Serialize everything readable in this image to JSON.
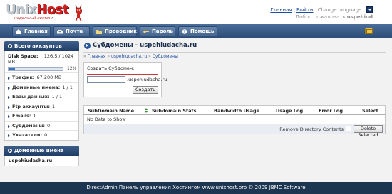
{
  "header": {
    "logo_text_part1": "Unix",
    "logo_text_part2": "Host",
    "logo_tagline": "надежный хостинг",
    "link_home": "Главная",
    "link_logout": "Выйти",
    "separator": "|",
    "language": "Change language...",
    "welcome_prefix": "Добро пожаловать",
    "username": "uspehiud"
  },
  "nav": {
    "items": [
      {
        "label": "Главная",
        "icon": "home-icon"
      },
      {
        "label": "Почта",
        "icon": "mail-icon"
      },
      {
        "label": "Проводник",
        "icon": "folder-icon"
      },
      {
        "label": "Пароль",
        "icon": "key-icon"
      },
      {
        "label": "Помощь",
        "icon": "help-icon"
      }
    ]
  },
  "sidebar": {
    "accounts_title": "Всего аккаунтов",
    "disk_label": "Disk Space:",
    "disk_value": "126.5 / 1024 MB",
    "disk_percent_label": "12%",
    "disk_percent": 12,
    "stats": [
      {
        "label": "Трафик:",
        "value": "67.200 MB"
      },
      {
        "label": "Доменные имена:",
        "value": "1 / 1"
      },
      {
        "label": "Базы данных:",
        "value": "1 / 1"
      },
      {
        "label": "Ftp аккаунты:",
        "value": "1"
      },
      {
        "label": "Emails:",
        "value": "1"
      },
      {
        "label": "Субдомены:",
        "value": "0"
      },
      {
        "label": "Указатели:",
        "value": "0"
      }
    ],
    "domains_title": "Доменные имена",
    "domains": [
      "uspehiudacha.ru"
    ]
  },
  "content": {
    "title": "Субдомены - uspehiudacha.ru",
    "breadcrumb": [
      {
        "label": "Главная"
      },
      {
        "label": "uspehiudacha.ru"
      },
      {
        "label": "Субдомены"
      }
    ],
    "breadcrumb_prefix": "»",
    "breadcrumb_sep": "»",
    "create_label": "Создать Субдомен:",
    "create_input_value": "",
    "create_suffix": ".uspehiudacha.ru",
    "create_button": "Создать",
    "table": {
      "columns": [
        "SubDomain Name",
        "Subdomain Stats",
        "Bandwidth Usage",
        "Usage Log",
        "Error Log",
        "Select"
      ],
      "empty_text": "No Data to Show",
      "remove_dir_label": "Remove Directory Contents",
      "delete_button": "Delete Selected"
    }
  },
  "footer": {
    "link": "DirectAdmin",
    "text": " Панель управления Хостингом www.unixhost.pro © 2009 JBMC Software"
  },
  "colors": {
    "nav_bg": "#2b4d77",
    "page_bg": "#1c3550",
    "accent_red": "#cc1f1f",
    "link": "#1f4ea0"
  }
}
